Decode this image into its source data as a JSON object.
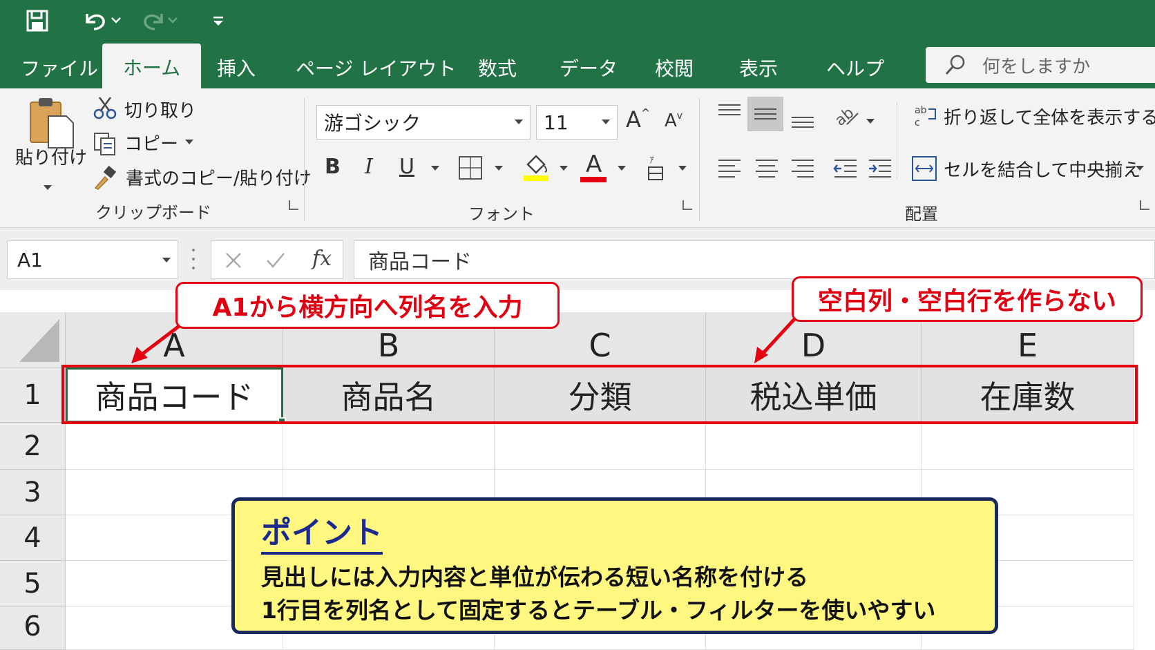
{
  "colors": {
    "excel_green": "#217346",
    "annotation_red": "#e50012",
    "point_bg": "#fff77f",
    "point_border": "#1a2a5e"
  },
  "quick_access": {
    "icons": [
      "save-icon",
      "undo-icon",
      "redo-icon",
      "customize-icon"
    ]
  },
  "tabs": [
    "ファイル",
    "ホーム",
    "挿入",
    "ページ レイアウト",
    "数式",
    "データ",
    "校閲",
    "表示",
    "ヘルプ"
  ],
  "active_tab": "ホーム",
  "search": {
    "placeholder": "何をしますか"
  },
  "clipboard": {
    "paste": "貼り付け",
    "cut": "切り取り",
    "copy": "コピー",
    "format_painter": "書式のコピー/貼り付け",
    "label": "クリップボード"
  },
  "font": {
    "name": "游ゴシック",
    "size": "11",
    "label": "フォント",
    "bold": "B",
    "italic": "I",
    "underline": "U",
    "font_color_letter": "A",
    "highlight_color": "#ffff00",
    "font_color": "#e50012"
  },
  "alignment": {
    "wrap_text": "折り返して全体を表示する",
    "merge_center": "セルを結合して中央揃え",
    "label": "配置"
  },
  "formula_bar": {
    "name_box": "A1",
    "fx": "fx",
    "formula": "商品コード"
  },
  "columns": [
    "A",
    "B",
    "C",
    "D",
    "E"
  ],
  "rows": [
    "1",
    "2",
    "3",
    "4",
    "5",
    "6"
  ],
  "header_cells": [
    "商品コード",
    "商品名",
    "分類",
    "税込単価",
    "在庫数"
  ],
  "callouts": {
    "left": "A1から横方向へ列名を入力",
    "right": "空白列・空白行を作らない"
  },
  "point": {
    "title": "ポイント",
    "line1": "見出しには入力内容と単位が伝わる短い名称を付ける",
    "line2": "1行目を列名として固定するとテーブル・フィルターを使いやすい"
  }
}
